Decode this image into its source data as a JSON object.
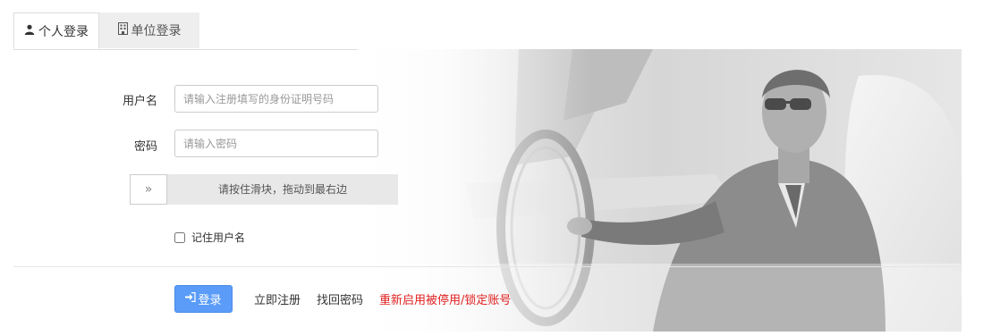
{
  "tabs": [
    {
      "label": "个人登录",
      "icon": "user-icon",
      "active": true
    },
    {
      "label": "单位登录",
      "icon": "building-icon",
      "active": false
    }
  ],
  "form": {
    "username": {
      "label": "用户名",
      "value": "",
      "placeholder": "请输入注册填写的身份证明号码"
    },
    "password": {
      "label": "密码",
      "value": "",
      "placeholder": "请输入密码"
    },
    "slider": {
      "handle_glyph": "»",
      "hint": "请按住滑块，拖动到最右边"
    },
    "remember": {
      "label": "记住用户名",
      "checked": false
    }
  },
  "actions": {
    "login_label": "登录",
    "login_icon": "sign-in-icon",
    "register_label": "立即注册",
    "recover_label": "找回密码",
    "reactivate_label": "重新启用被停用/锁定账号"
  },
  "colors": {
    "primary": "#5a9cf8",
    "danger": "#e02020",
    "tab_inactive_bg": "#eeeeee",
    "slider_track": "#e8e8e8"
  }
}
